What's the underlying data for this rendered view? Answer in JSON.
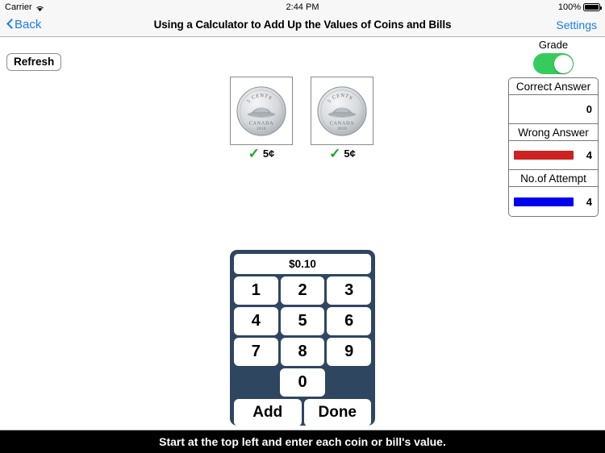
{
  "status_bar": {
    "carrier": "Carrier",
    "wifi_icon": "wifi-icon",
    "time": "2:44 PM",
    "battery_percent": "100%",
    "battery_icon": "battery-full-icon"
  },
  "nav_bar": {
    "back_label": "Back",
    "back_icon": "chevron-left-icon",
    "title": "Using a Calculator to Add Up the Values of Coins and Bills",
    "settings_label": "Settings"
  },
  "toolbar": {
    "refresh_label": "Refresh"
  },
  "coins": [
    {
      "image": "canadian-5-cent-coin",
      "check_icon": "check-mark-icon",
      "value_label": "5¢",
      "denomination_text": "5 CENTS",
      "country_text": "CANADA",
      "year_text": "2010"
    },
    {
      "image": "canadian-5-cent-coin",
      "check_icon": "check-mark-icon",
      "value_label": "5¢",
      "denomination_text": "5 CENTS",
      "country_text": "CANADA",
      "year_text": "2010"
    }
  ],
  "grade_panel": {
    "label": "Grade",
    "toggle_on": true,
    "toggle_color": "#35cc5d",
    "stats": [
      {
        "header": "Correct Answer",
        "value": "0",
        "bar_width_pct": 0,
        "bar_color": "#000000",
        "has_bar": false
      },
      {
        "header": "Wrong Answer",
        "value": "4",
        "bar_width_pct": 76,
        "bar_color": "#cc2222",
        "has_bar": true
      },
      {
        "header": "No.of Attempt",
        "value": "4",
        "bar_width_pct": 76,
        "bar_color": "#0000ee",
        "has_bar": true
      }
    ]
  },
  "calculator": {
    "display_value": "$0.10",
    "keys_row1": [
      "1",
      "2",
      "3"
    ],
    "keys_row2": [
      "4",
      "5",
      "6"
    ],
    "keys_row3": [
      "7",
      "8",
      "9"
    ],
    "key_zero": "0",
    "add_label": "Add",
    "done_label": "Done",
    "background_color": "#2e465f"
  },
  "footer": {
    "message": "Start at the top left and enter each coin or bill's value."
  }
}
